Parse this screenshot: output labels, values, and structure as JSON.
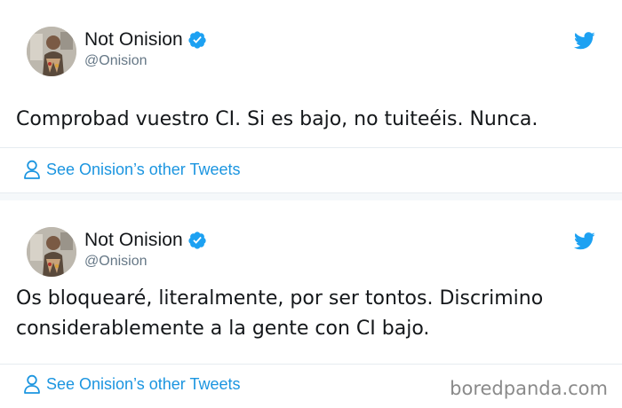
{
  "colors": {
    "accent": "#1da1f2",
    "link": "#1b95e0",
    "handle_gray": "#657786",
    "text": "#14171a",
    "divider": "#e6ecf0"
  },
  "tweets": [
    {
      "display_name": "Not Onision",
      "handle": "@Onision",
      "verified_icon": "verified-badge-icon",
      "brand_icon": "twitter-bird-icon",
      "text": "Comprobad vuestro CI. Si es bajo, no tuiteéis. Nunca.",
      "footer_icon": "person-icon",
      "footer_link": "See Onision’s other Tweets"
    },
    {
      "display_name": "Not Onision",
      "handle": "@Onision",
      "verified_icon": "verified-badge-icon",
      "brand_icon": "twitter-bird-icon",
      "text": "Os bloquearé, literalmente, por ser tontos. Discrimino considerablemente a la gente con CI bajo.",
      "footer_icon": "person-icon",
      "footer_link": "See Onision’s other Tweets"
    }
  ],
  "watermark": "boredpanda.com"
}
